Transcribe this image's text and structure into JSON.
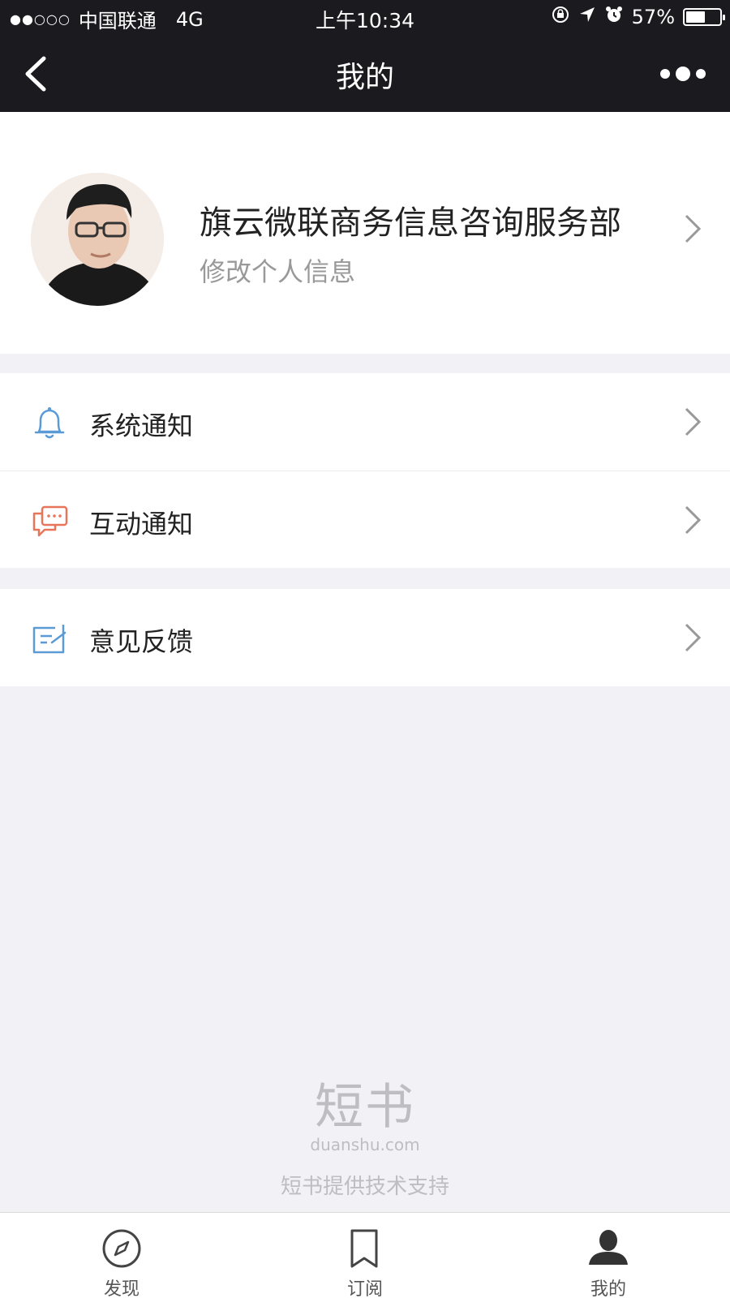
{
  "status_bar": {
    "signal": "●●○○○",
    "carrier": "中国联通",
    "network": "4G",
    "time": "上午10:34",
    "battery": "57%",
    "battery_level": 0.57
  },
  "nav": {
    "title": "我的"
  },
  "profile": {
    "name": "旗云微联商务信息咨询服务部",
    "edit_label": "修改个人信息"
  },
  "menu": {
    "system_notice": "系统通知",
    "interaction_notice": "互动通知",
    "feedback": "意见反馈"
  },
  "footer": {
    "logo": "短书",
    "domain": "duanshu.com",
    "support": "短书提供技术支持"
  },
  "tabs": [
    {
      "label": "发现",
      "icon": "compass-icon"
    },
    {
      "label": "订阅",
      "icon": "bookmark-icon"
    },
    {
      "label": "我的",
      "icon": "user-icon"
    }
  ],
  "colors": {
    "bar_bg": "#1b1a1f",
    "bell_blue": "#5b9bd5",
    "chat_orange": "#e8745a",
    "feedback_blue": "#5b9bd5"
  }
}
